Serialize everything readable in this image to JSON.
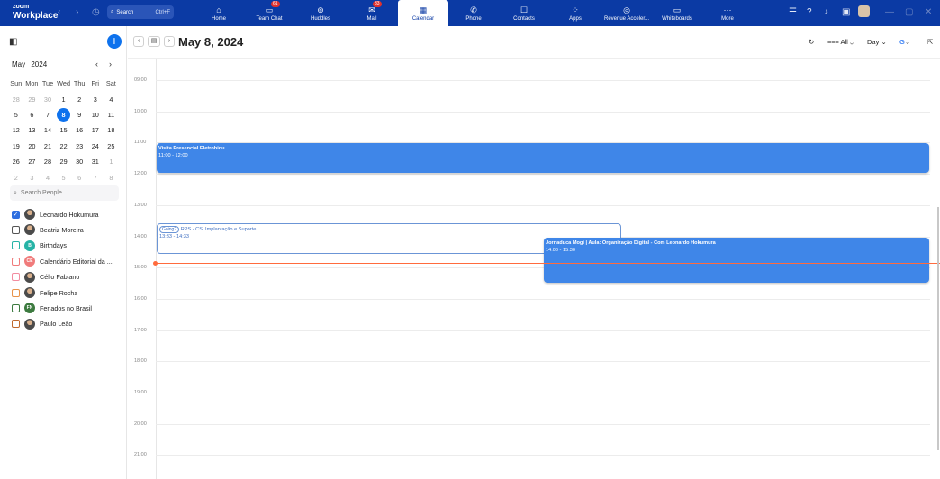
{
  "topbar": {
    "brand_small": "zoom",
    "brand_big": "Workplace",
    "search_label": "Search",
    "search_shortcut": "Ctrl+F",
    "tabs": [
      {
        "label": "Home",
        "icon": "home-icon",
        "badge": ""
      },
      {
        "label": "Team Chat",
        "icon": "chat-icon",
        "badge": "61"
      },
      {
        "label": "Huddles",
        "icon": "huddles-icon",
        "badge": ""
      },
      {
        "label": "Mail",
        "icon": "mail-icon",
        "badge": "33"
      },
      {
        "label": "Calendar",
        "icon": "calendar-icon",
        "badge": "",
        "active": true
      },
      {
        "label": "Phone",
        "icon": "phone-icon",
        "badge": ""
      },
      {
        "label": "Contacts",
        "icon": "contacts-icon",
        "badge": ""
      },
      {
        "label": "Apps",
        "icon": "apps-icon",
        "badge": ""
      },
      {
        "label": "Revenue Acceler...",
        "icon": "revenue-icon",
        "badge": ""
      },
      {
        "label": "Whiteboards",
        "icon": "whiteboard-icon",
        "badge": ""
      },
      {
        "label": "More",
        "icon": "more-icon",
        "badge": ""
      }
    ],
    "accent": "#0b3aa4"
  },
  "sidebar": {
    "mini_month": "May",
    "mini_year": "2024",
    "weekdays": [
      "Sun",
      "Mon",
      "Tue",
      "Wed",
      "Thu",
      "Fri",
      "Sat"
    ],
    "weeks": [
      [
        "28",
        "29",
        "30",
        "1",
        "2",
        "3",
        "4"
      ],
      [
        "5",
        "6",
        "7",
        "8",
        "9",
        "10",
        "11"
      ],
      [
        "12",
        "13",
        "14",
        "15",
        "16",
        "17",
        "18"
      ],
      [
        "19",
        "20",
        "21",
        "22",
        "23",
        "24",
        "25"
      ],
      [
        "26",
        "27",
        "28",
        "29",
        "30",
        "31",
        "1"
      ],
      [
        "2",
        "3",
        "4",
        "5",
        "6",
        "7",
        "8"
      ]
    ],
    "today": "8",
    "people_placeholder": "Search People...",
    "calendars": [
      {
        "label": "Leonardo Hokumura",
        "checked": true,
        "color": "#2f6fe0",
        "avatar": "photo",
        "initials": ""
      },
      {
        "label": "Beatriz Moreira",
        "checked": false,
        "color": "#555555",
        "avatar": "photo",
        "initials": ""
      },
      {
        "label": "Birthdays",
        "checked": false,
        "color": "#26b3a6",
        "avatar": "color",
        "initials": "B"
      },
      {
        "label": "Calendário Editorial da ...",
        "checked": false,
        "color": "#f07b7b",
        "avatar": "color",
        "initials": "CE"
      },
      {
        "label": "Célio Fabiano",
        "checked": false,
        "color": "#f28ca0",
        "avatar": "photo",
        "initials": ""
      },
      {
        "label": "Felipe Rocha",
        "checked": false,
        "color": "#e8934a",
        "avatar": "photo",
        "initials": ""
      },
      {
        "label": "Feriados no Brasil",
        "checked": false,
        "color": "#3c7a3f",
        "avatar": "color",
        "initials": "FN"
      },
      {
        "label": "Paulo Leão",
        "checked": false,
        "color": "#c0692e",
        "avatar": "photo",
        "initials": ""
      }
    ]
  },
  "toolbar": {
    "date_title": "May 8, 2024",
    "filter_label": "All",
    "view_label": "Day"
  },
  "day": {
    "hours": [
      "09:00",
      "10:00",
      "11:00",
      "12:00",
      "13:00",
      "14:00",
      "15:00",
      "16:00",
      "17:00",
      "18:00",
      "19:00",
      "20:00",
      "21:00"
    ],
    "events": [
      {
        "title": "Visita Presencial Eletrobidu",
        "time": "11:00 - 12:00",
        "style": "solid"
      },
      {
        "title": "RPS - CS, Implantação e Suporte",
        "time": "13:33 - 14:33",
        "style": "outline",
        "tag": "Going?"
      },
      {
        "title": "Jornaduca Mogi | Aula: Organização Digital - Com Leonardo Hokumura",
        "time": "14:00 - 15:30",
        "style": "solid"
      }
    ],
    "now_color": "#ff6b3d",
    "event_color": "#3f86e8"
  }
}
